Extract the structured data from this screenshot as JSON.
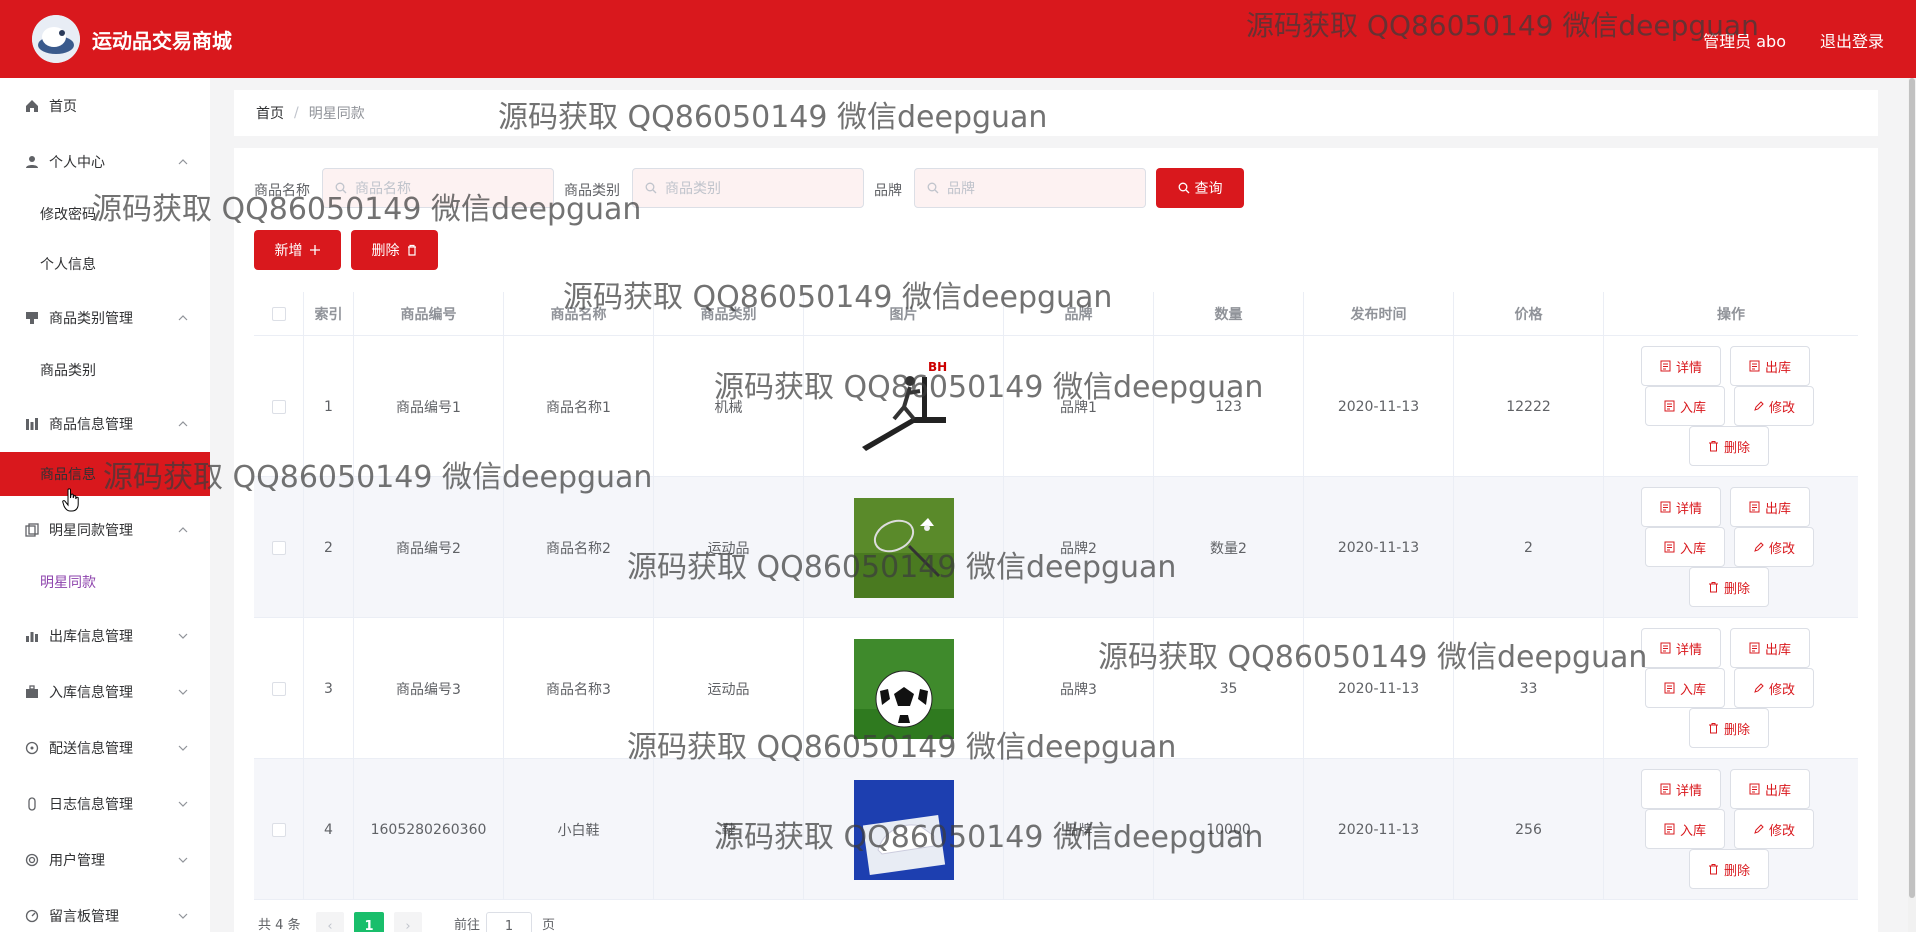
{
  "header": {
    "app_title": "运动品交易商城",
    "admin_label": "管理员 abo",
    "logout_label": "退出登录",
    "brand_color": "#d9181d"
  },
  "sidebar": {
    "items": [
      {
        "label": "首页",
        "icon": "home-icon"
      },
      {
        "label": "个人中心",
        "icon": "user-icon",
        "expanded": true,
        "children": [
          "修改密码",
          "个人信息"
        ]
      },
      {
        "label": "商品类别管理",
        "icon": "category-icon",
        "expanded": true,
        "children": [
          "商品类别"
        ]
      },
      {
        "label": "商品信息管理",
        "icon": "product-icon",
        "expanded": true,
        "children": [
          "商品信息"
        ]
      },
      {
        "label": "明星同款管理",
        "icon": "copy-icon",
        "expanded": true,
        "children": [
          "明星同款"
        ]
      },
      {
        "label": "出库信息管理",
        "icon": "bar-chart-icon",
        "expanded": false
      },
      {
        "label": "入库信息管理",
        "icon": "briefcase-icon",
        "expanded": false
      },
      {
        "label": "配送信息管理",
        "icon": "delivery-icon",
        "expanded": false
      },
      {
        "label": "日志信息管理",
        "icon": "log-icon",
        "expanded": false
      },
      {
        "label": "用户管理",
        "icon": "users-icon",
        "expanded": false
      },
      {
        "label": "留言板管理",
        "icon": "message-icon",
        "expanded": false
      }
    ],
    "active_color": "#d9181d",
    "selected_link_color": "#8e44ad"
  },
  "breadcrumb": {
    "home": "首页",
    "separator": "/",
    "current": "明星同款"
  },
  "search": {
    "name_label": "商品名称",
    "name_placeholder": "商品名称",
    "category_label": "商品类别",
    "category_placeholder": "商品类别",
    "brand_label": "品牌",
    "brand_placeholder": "品牌",
    "query_label": "查询"
  },
  "actions": {
    "add_label": "新增",
    "delete_label": "删除"
  },
  "table": {
    "columns": [
      "索引",
      "商品编号",
      "商品名称",
      "商品类别",
      "图片",
      "品牌",
      "数量",
      "发布时间",
      "价格",
      "操作"
    ],
    "rows": [
      {
        "index": "1",
        "code": "商品编号1",
        "name": "商品名称1",
        "category": "机械",
        "image": "treadmill",
        "brand": "品牌1",
        "qty": "123",
        "date": "2020-11-13",
        "price": "12222"
      },
      {
        "index": "2",
        "code": "商品编号2",
        "name": "商品名称2",
        "category": "运动品",
        "image": "badminton",
        "brand": "品牌2",
        "qty": "数量2",
        "date": "2020-11-13",
        "price": "2"
      },
      {
        "index": "3",
        "code": "商品编号3",
        "name": "商品名称3",
        "category": "运动品",
        "image": "soccer-ball",
        "brand": "品牌3",
        "qty": "35",
        "date": "2020-11-13",
        "price": "33"
      },
      {
        "index": "4",
        "code": "1605280260360",
        "name": "小白鞋",
        "category": "鞋",
        "image": "white-shoe",
        "brand": "品牌",
        "qty": "10000",
        "date": "2020-11-13",
        "price": "256"
      }
    ],
    "row_actions": {
      "detail": "详情",
      "out": "出库",
      "in": "入库",
      "edit": "修改",
      "delete": "删除"
    }
  },
  "pagination": {
    "total": "共 4 条",
    "current_page": "1",
    "goto_prefix": "前往",
    "goto_value": "1",
    "goto_suffix": "页",
    "prev": "‹",
    "next": "›"
  },
  "watermark_text": "源码获取 QQ86050149 微信deepguan"
}
